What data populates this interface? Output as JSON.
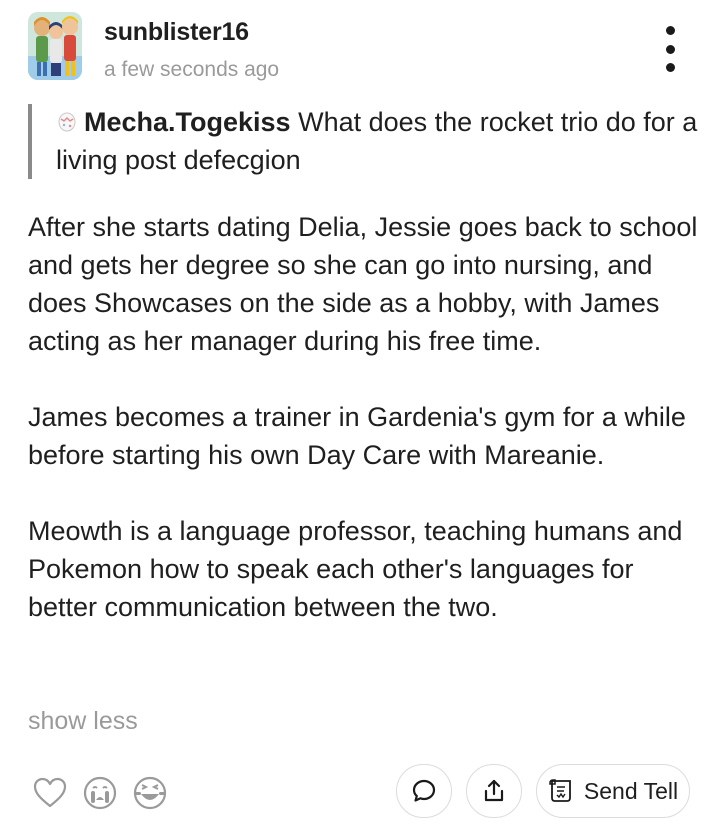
{
  "post": {
    "username": "sunblister16",
    "timestamp": "a few seconds ago",
    "quote": {
      "author": "Mecha.Togekiss",
      "text": "What does the rocket trio do for a living post defecgion"
    },
    "paragraphs": [
      "After she starts dating Delia, Jessie goes back to school and gets her degree so she can go into nursing, and does Showcases on the side as a hobby, with James acting as her manager during his free time.",
      "James becomes a trainer in Gardenia's gym for a while before starting his own Day Care with Mareanie.",
      "Meowth is a language professor, teaching humans and Pokemon how to speak each other's languages for better communication between the two."
    ],
    "show_less_label": "show less"
  },
  "actions": {
    "send_tell_label": "Send Tell"
  },
  "icons": {
    "more": "more-vertical-icon",
    "quote_avatar": "egg-icon",
    "like": "heart-icon",
    "cry": "crying-face-icon",
    "laugh": "laughing-face-icon",
    "comment": "comment-bubble-icon",
    "share": "share-icon",
    "tell": "letter-icon"
  }
}
